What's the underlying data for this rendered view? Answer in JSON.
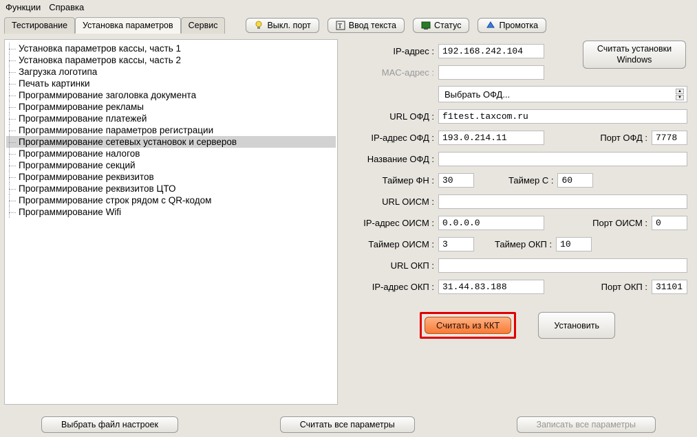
{
  "menu": {
    "functions": "Функции",
    "help": "Справка"
  },
  "tabs": {
    "testing": "Тестирование",
    "params": "Установка параметров",
    "service": "Сервис"
  },
  "toolbar": {
    "port_off": "Выкл. порт",
    "text_input": "Ввод текста",
    "status": "Статус",
    "rewind": "Промотка"
  },
  "tree": [
    "Установка параметров кассы, часть 1",
    "Установка параметров кассы, часть 2",
    "Загрузка логотипа",
    "Печать картинки",
    "Программирование заголовка документа",
    "Программирование рекламы",
    "Программирование платежей",
    "Программирование параметров регистрации",
    "Программирование сетевых установок и серверов",
    "Программирование налогов",
    "Программирование секций",
    "Программирование реквизитов",
    "Программирование реквизитов ЦТО",
    "Программирование строк рядом с QR-кодом",
    "Программирование Wifi"
  ],
  "tree_selected": 8,
  "form": {
    "ip_label": "IP-адрес :",
    "ip_value": "192.168.242.104",
    "mac_label": "MAC-адрес :",
    "mac_value": "",
    "select_ofd_label": "Выбрать ОФД...",
    "url_ofd_label": "URL ОФД :",
    "url_ofd_value": "f1test.taxcom.ru",
    "ip_ofd_label": "IP-адрес ОФД :",
    "ip_ofd_value": "193.0.214.11",
    "port_ofd_label": "Порт ОФД :",
    "port_ofd_value": "7778",
    "name_ofd_label": "Название ОФД :",
    "name_ofd_value": "",
    "timer_fn_label": "Таймер ФН :",
    "timer_fn_value": "30",
    "timer_c_label": "Таймер С :",
    "timer_c_value": "60",
    "url_oism_label": "URL ОИСМ :",
    "url_oism_value": "",
    "ip_oism_label": "IP-адрес ОИСМ :",
    "ip_oism_value": "0.0.0.0",
    "port_oism_label": "Порт ОИСМ :",
    "port_oism_value": "0",
    "timer_oism_label": "Таймер ОИСМ :",
    "timer_oism_value": "3",
    "timer_okp_label": "Таймер ОКП :",
    "timer_okp_value": "10",
    "url_okp_label": "URL ОКП :",
    "url_okp_value": "",
    "ip_okp_label": "IP-адрес ОКП :",
    "ip_okp_value": "31.44.83.188",
    "port_okp_label": "Порт ОКП :",
    "port_okp_value": "31101",
    "read_windows": "Считать установки Windows",
    "read_kkt": "Считать из ККТ",
    "install": "Установить"
  },
  "bottom": {
    "choose_file": "Выбрать файл настроек",
    "read_all": "Считать все параметры",
    "write_all": "Записать все параметры"
  }
}
